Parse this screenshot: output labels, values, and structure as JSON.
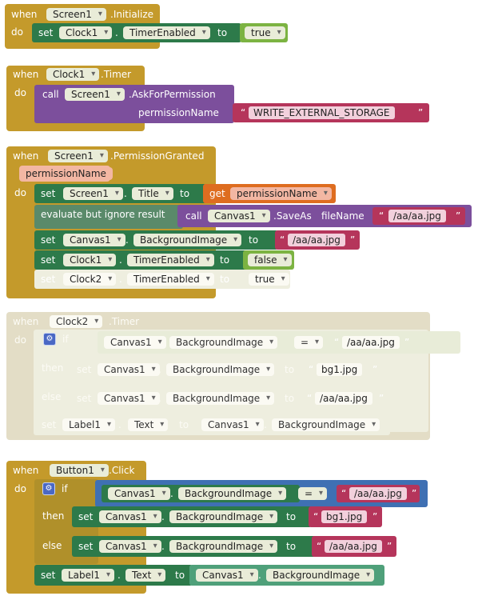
{
  "kw": {
    "when": "when",
    "do": "do",
    "set": "set",
    "to": "to",
    "call": "call",
    "get": "get",
    "if": "if",
    "then": "then",
    "else": "else",
    "dot": ".",
    "quote_open": "“",
    "quote_close": "”",
    "eq": "=",
    "evaluate": "evaluate but ignore result"
  },
  "blocks": [
    {
      "component": "Screen1",
      "event": ".Initialize",
      "statements": [
        {
          "target": "Clock1",
          "property": "TimerEnabled",
          "value": "true"
        }
      ]
    },
    {
      "component": "Clock1",
      "event": ".Timer",
      "method": {
        "component": "Screen1",
        "name": ".AskForPermission",
        "param_label": "permissionName",
        "arg": "WRITE_EXTERNAL_STORAGE"
      }
    },
    {
      "component": "Screen1",
      "event": ".PermissionGranted",
      "param": "permissionName",
      "statements": [
        {
          "target": "Screen1",
          "property": "Title",
          "get": "permissionName"
        },
        {
          "call": "Canvas1",
          "method": ".SaveAs",
          "param_label": "fileName",
          "arg": "/aa/aa.jpg"
        },
        {
          "target": "Canvas1",
          "property": "BackgroundImage",
          "value": "/aa/aa.jpg"
        },
        {
          "target": "Clock1",
          "property": "TimerEnabled",
          "value": "false"
        },
        {
          "target": "Clock2",
          "property": "TimerEnabled",
          "value": "true"
        }
      ]
    },
    {
      "component": "Clock2",
      "event": ".Timer",
      "disabled": true,
      "cond": {
        "component": "Canvas1",
        "property": "BackgroundImage",
        "op": "=",
        "value": "/aa/aa.jpg"
      },
      "then": {
        "target": "Canvas1",
        "property": "BackgroundImage",
        "value": "bg1.jpg"
      },
      "else": {
        "target": "Canvas1",
        "property": "BackgroundImage",
        "value": "/aa/aa.jpg"
      },
      "after": {
        "target": "Label1",
        "property": "Text",
        "source_component": "Canvas1",
        "source_property": "BackgroundImage"
      }
    },
    {
      "component": "Button1",
      "event": ".Click",
      "cond": {
        "component": "Canvas1",
        "property": "BackgroundImage",
        "op": "=",
        "value": "/aa/aa.jpg"
      },
      "then": {
        "target": "Canvas1",
        "property": "BackgroundImage",
        "value": "bg1.jpg"
      },
      "else": {
        "target": "Canvas1",
        "property": "BackgroundImage",
        "value": "/aa/aa.jpg"
      },
      "after": {
        "target": "Label1",
        "property": "Text",
        "source_component": "Canvas1",
        "source_property": "BackgroundImage"
      }
    }
  ]
}
